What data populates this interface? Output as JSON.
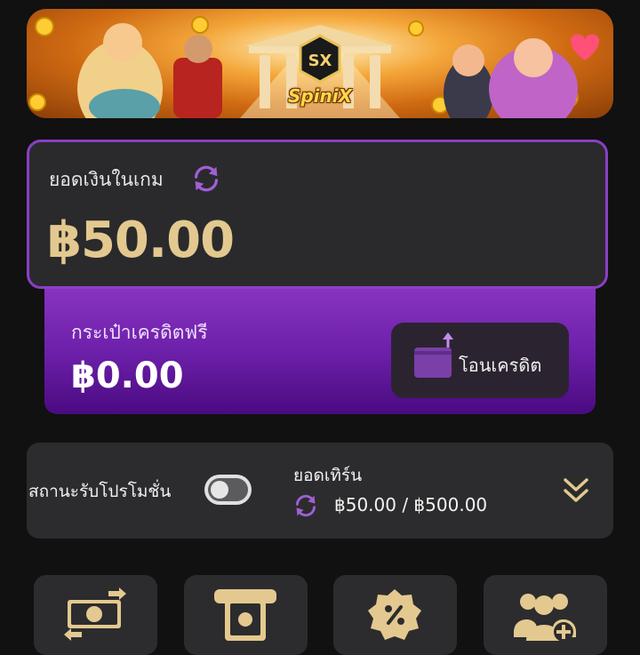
{
  "banner": {
    "logo_text": "SpiniX",
    "logo_icon": "spinix-logo-icon"
  },
  "balance": {
    "label": "ยอดเงินในเกม",
    "amount": "฿50.00",
    "refresh_icon": "refresh-icon"
  },
  "free_credit": {
    "label": "กระเป๋าเครดิตฟรี",
    "amount": "฿0.00",
    "transfer_label": "โอนเครดิต",
    "transfer_icon": "wallet-transfer-icon"
  },
  "promotion": {
    "status_label": "สถานะรับโปรโมชั่น",
    "toggle_on": false,
    "turnover_title": "ยอดเทิร์น",
    "turnover_value": "฿50.00 / ฿500.00",
    "expand_icon": "double-chevron-down-icon"
  },
  "quick_menu": [
    {
      "icon": "money-exchange-icon"
    },
    {
      "icon": "atm-withdraw-icon"
    },
    {
      "icon": "discount-badge-icon"
    },
    {
      "icon": "add-friends-icon"
    }
  ],
  "colors": {
    "background": "#111111",
    "card": "#2a2a2c",
    "purple_border": "#8b3fc6",
    "gold": "#e3c98f",
    "purple_icon": "#a05fd6"
  }
}
